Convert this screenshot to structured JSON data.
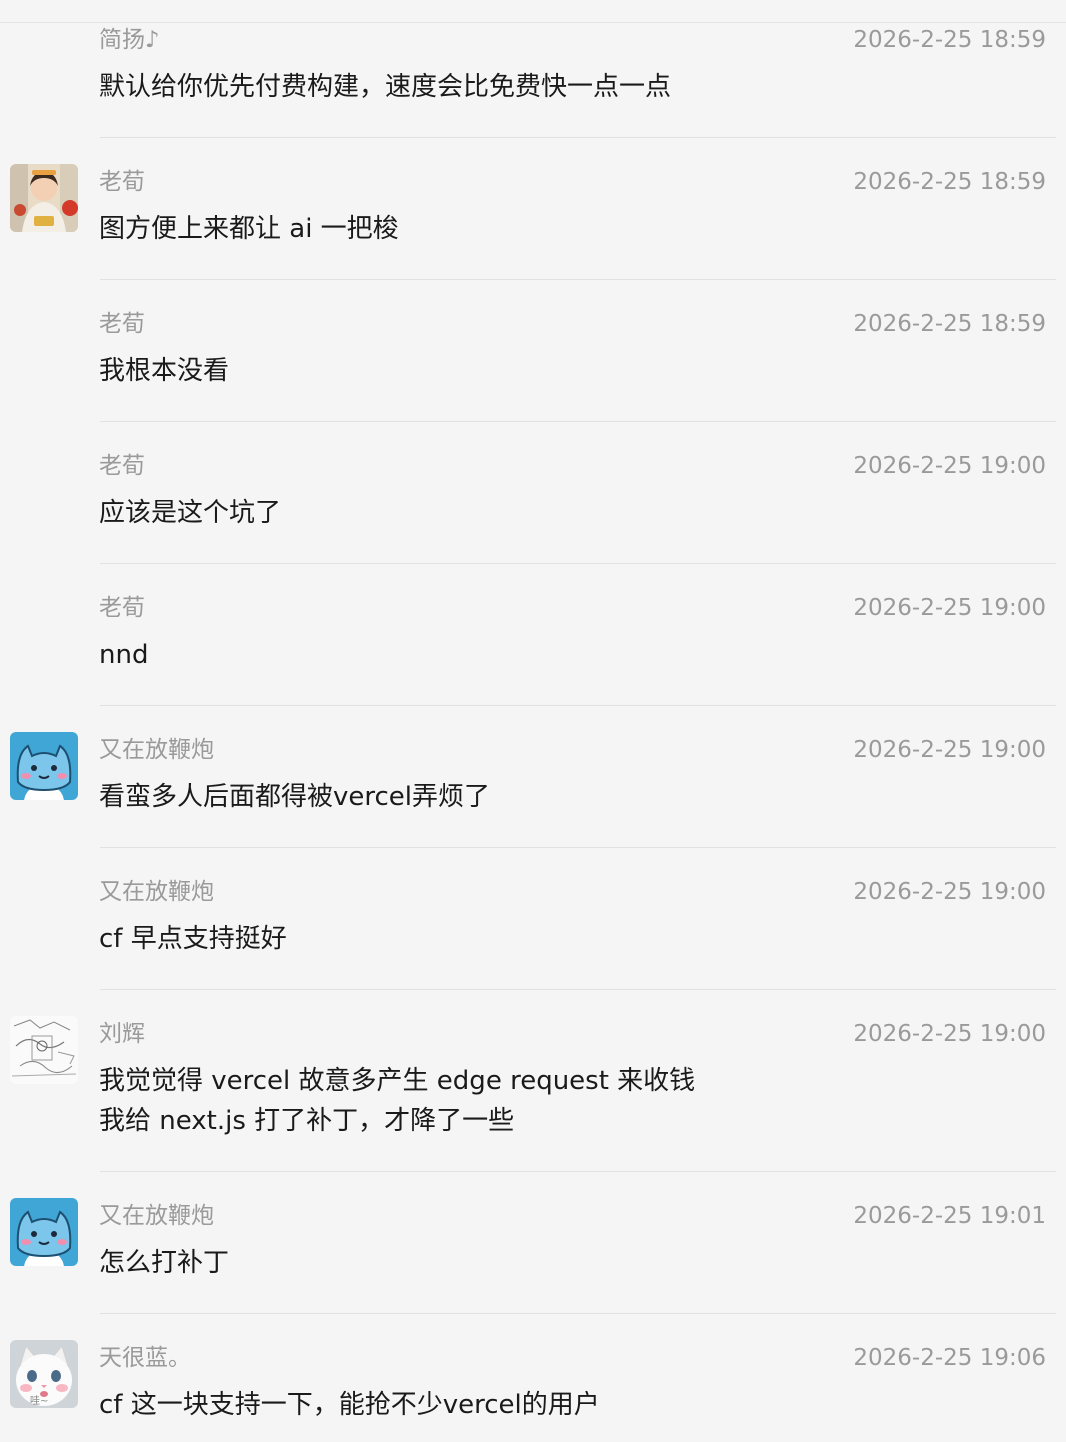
{
  "messages": [
    {
      "sender": "简扬♪",
      "time": "2026-2-25 18:59",
      "lines": [
        "默认给你优先付费构建，速度会比免费快一点一点"
      ],
      "avatar": null
    },
    {
      "sender": "老荀",
      "time": "2026-2-25 18:59",
      "lines": [
        "图方便上来都让 ai 一把梭"
      ],
      "avatar": "girl-avatar"
    },
    {
      "sender": "老荀",
      "time": "2026-2-25 18:59",
      "lines": [
        "我根本没看"
      ],
      "avatar": null
    },
    {
      "sender": "老荀",
      "time": "2026-2-25 19:00",
      "lines": [
        "应该是这个坑了"
      ],
      "avatar": null
    },
    {
      "sender": "老荀",
      "time": "2026-2-25 19:00",
      "lines": [
        "nnd"
      ],
      "avatar": null
    },
    {
      "sender": "又在放鞭炮",
      "time": "2026-2-25 19:00",
      "lines": [
        "看蛮多人后面都得被vercel弄烦了"
      ],
      "avatar": "blue-cat-avatar"
    },
    {
      "sender": "又在放鞭炮",
      "time": "2026-2-25 19:00",
      "lines": [
        "cf 早点支持挺好"
      ],
      "avatar": null
    },
    {
      "sender": "刘辉",
      "time": "2026-2-25 19:00",
      "lines": [
        "我觉觉得 vercel 故意多产生 edge request 来收钱",
        "我给 next.js 打了补丁，才降了一些"
      ],
      "avatar": "sketch-avatar"
    },
    {
      "sender": "又在放鞭炮",
      "time": "2026-2-25 19:01",
      "lines": [
        "怎么打补丁"
      ],
      "avatar": "blue-cat-avatar"
    },
    {
      "sender": "天很蓝。",
      "time": "2026-2-25 19:06",
      "lines": [
        "cf 这一块支持一下，能抢不少vercel的用户"
      ],
      "avatar": "white-cat-avatar",
      "avatar_text": "哇~"
    }
  ]
}
